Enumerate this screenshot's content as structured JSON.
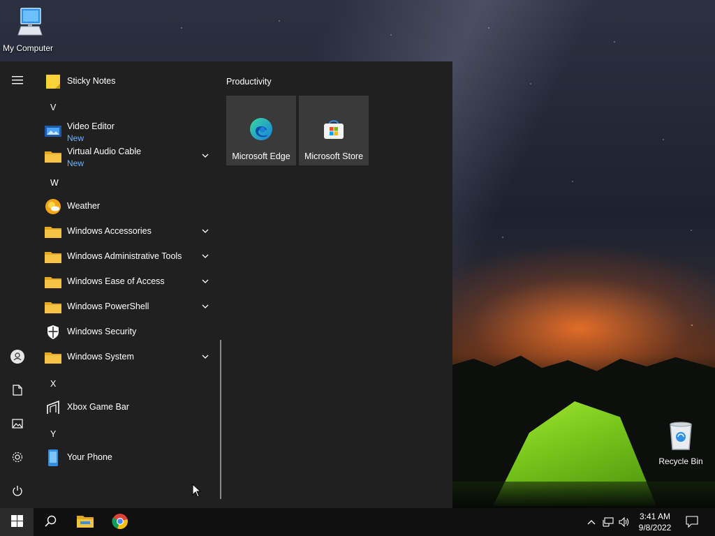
{
  "desktop": {
    "icons": [
      {
        "label": "My Computer",
        "icon": "computer-icon"
      },
      {
        "label": "Recycle Bin",
        "icon": "recycle-bin-icon"
      }
    ]
  },
  "start_menu": {
    "rail": {
      "items": [
        {
          "name": "hamburger-menu-icon"
        },
        {
          "name": "user-account-icon"
        },
        {
          "name": "documents-icon"
        },
        {
          "name": "pictures-icon"
        },
        {
          "name": "settings-gear-icon"
        },
        {
          "name": "power-icon"
        }
      ]
    },
    "app_list": {
      "items": [
        {
          "type": "app",
          "label": "Sticky Notes",
          "icon": "sticky-notes-icon"
        },
        {
          "type": "letter",
          "label": "V"
        },
        {
          "type": "app",
          "label": "Video Editor",
          "badge": "New",
          "icon": "video-editor-icon"
        },
        {
          "type": "folder",
          "label": "Virtual Audio Cable",
          "badge": "New",
          "icon": "folder-icon"
        },
        {
          "type": "letter",
          "label": "W"
        },
        {
          "type": "app",
          "label": "Weather",
          "icon": "weather-icon"
        },
        {
          "type": "folder",
          "label": "Windows Accessories",
          "icon": "folder-icon"
        },
        {
          "type": "folder",
          "label": "Windows Administrative Tools",
          "icon": "folder-icon"
        },
        {
          "type": "folder",
          "label": "Windows Ease of Access",
          "icon": "folder-icon"
        },
        {
          "type": "folder",
          "label": "Windows PowerShell",
          "icon": "folder-icon"
        },
        {
          "type": "app",
          "label": "Windows Security",
          "icon": "shield-icon"
        },
        {
          "type": "folder",
          "label": "Windows System",
          "icon": "folder-icon"
        },
        {
          "type": "letter",
          "label": "X"
        },
        {
          "type": "app",
          "label": "Xbox Game Bar",
          "icon": "xbox-game-bar-icon"
        },
        {
          "type": "letter",
          "label": "Y"
        },
        {
          "type": "app",
          "label": "Your Phone",
          "icon": "phone-icon"
        }
      ]
    },
    "tiles": {
      "group_title": "Productivity",
      "items": [
        {
          "label": "Microsoft Edge",
          "icon": "edge-icon"
        },
        {
          "label": "Microsoft Store",
          "icon": "store-icon"
        }
      ]
    }
  },
  "taskbar": {
    "pinned": [
      {
        "name": "start-button",
        "icon": "windows-logo-icon"
      },
      {
        "name": "search-button",
        "icon": "search-icon"
      },
      {
        "name": "file-explorer-button",
        "icon": "folder-icon"
      },
      {
        "name": "chrome-button",
        "icon": "chrome-icon"
      }
    ],
    "tray": {
      "icons": [
        "chevron-up-icon",
        "network-icon",
        "volume-icon"
      ],
      "time": "3:41 AM",
      "date": "9/8/2022",
      "notification_icon": "action-center-icon"
    }
  },
  "colors": {
    "menu_bg": "#202020",
    "tile_bg": "#3a3a3a",
    "badge_new": "#6db5ff",
    "folder_yellow": "#f5c344",
    "taskbar_bg": "#101010"
  }
}
